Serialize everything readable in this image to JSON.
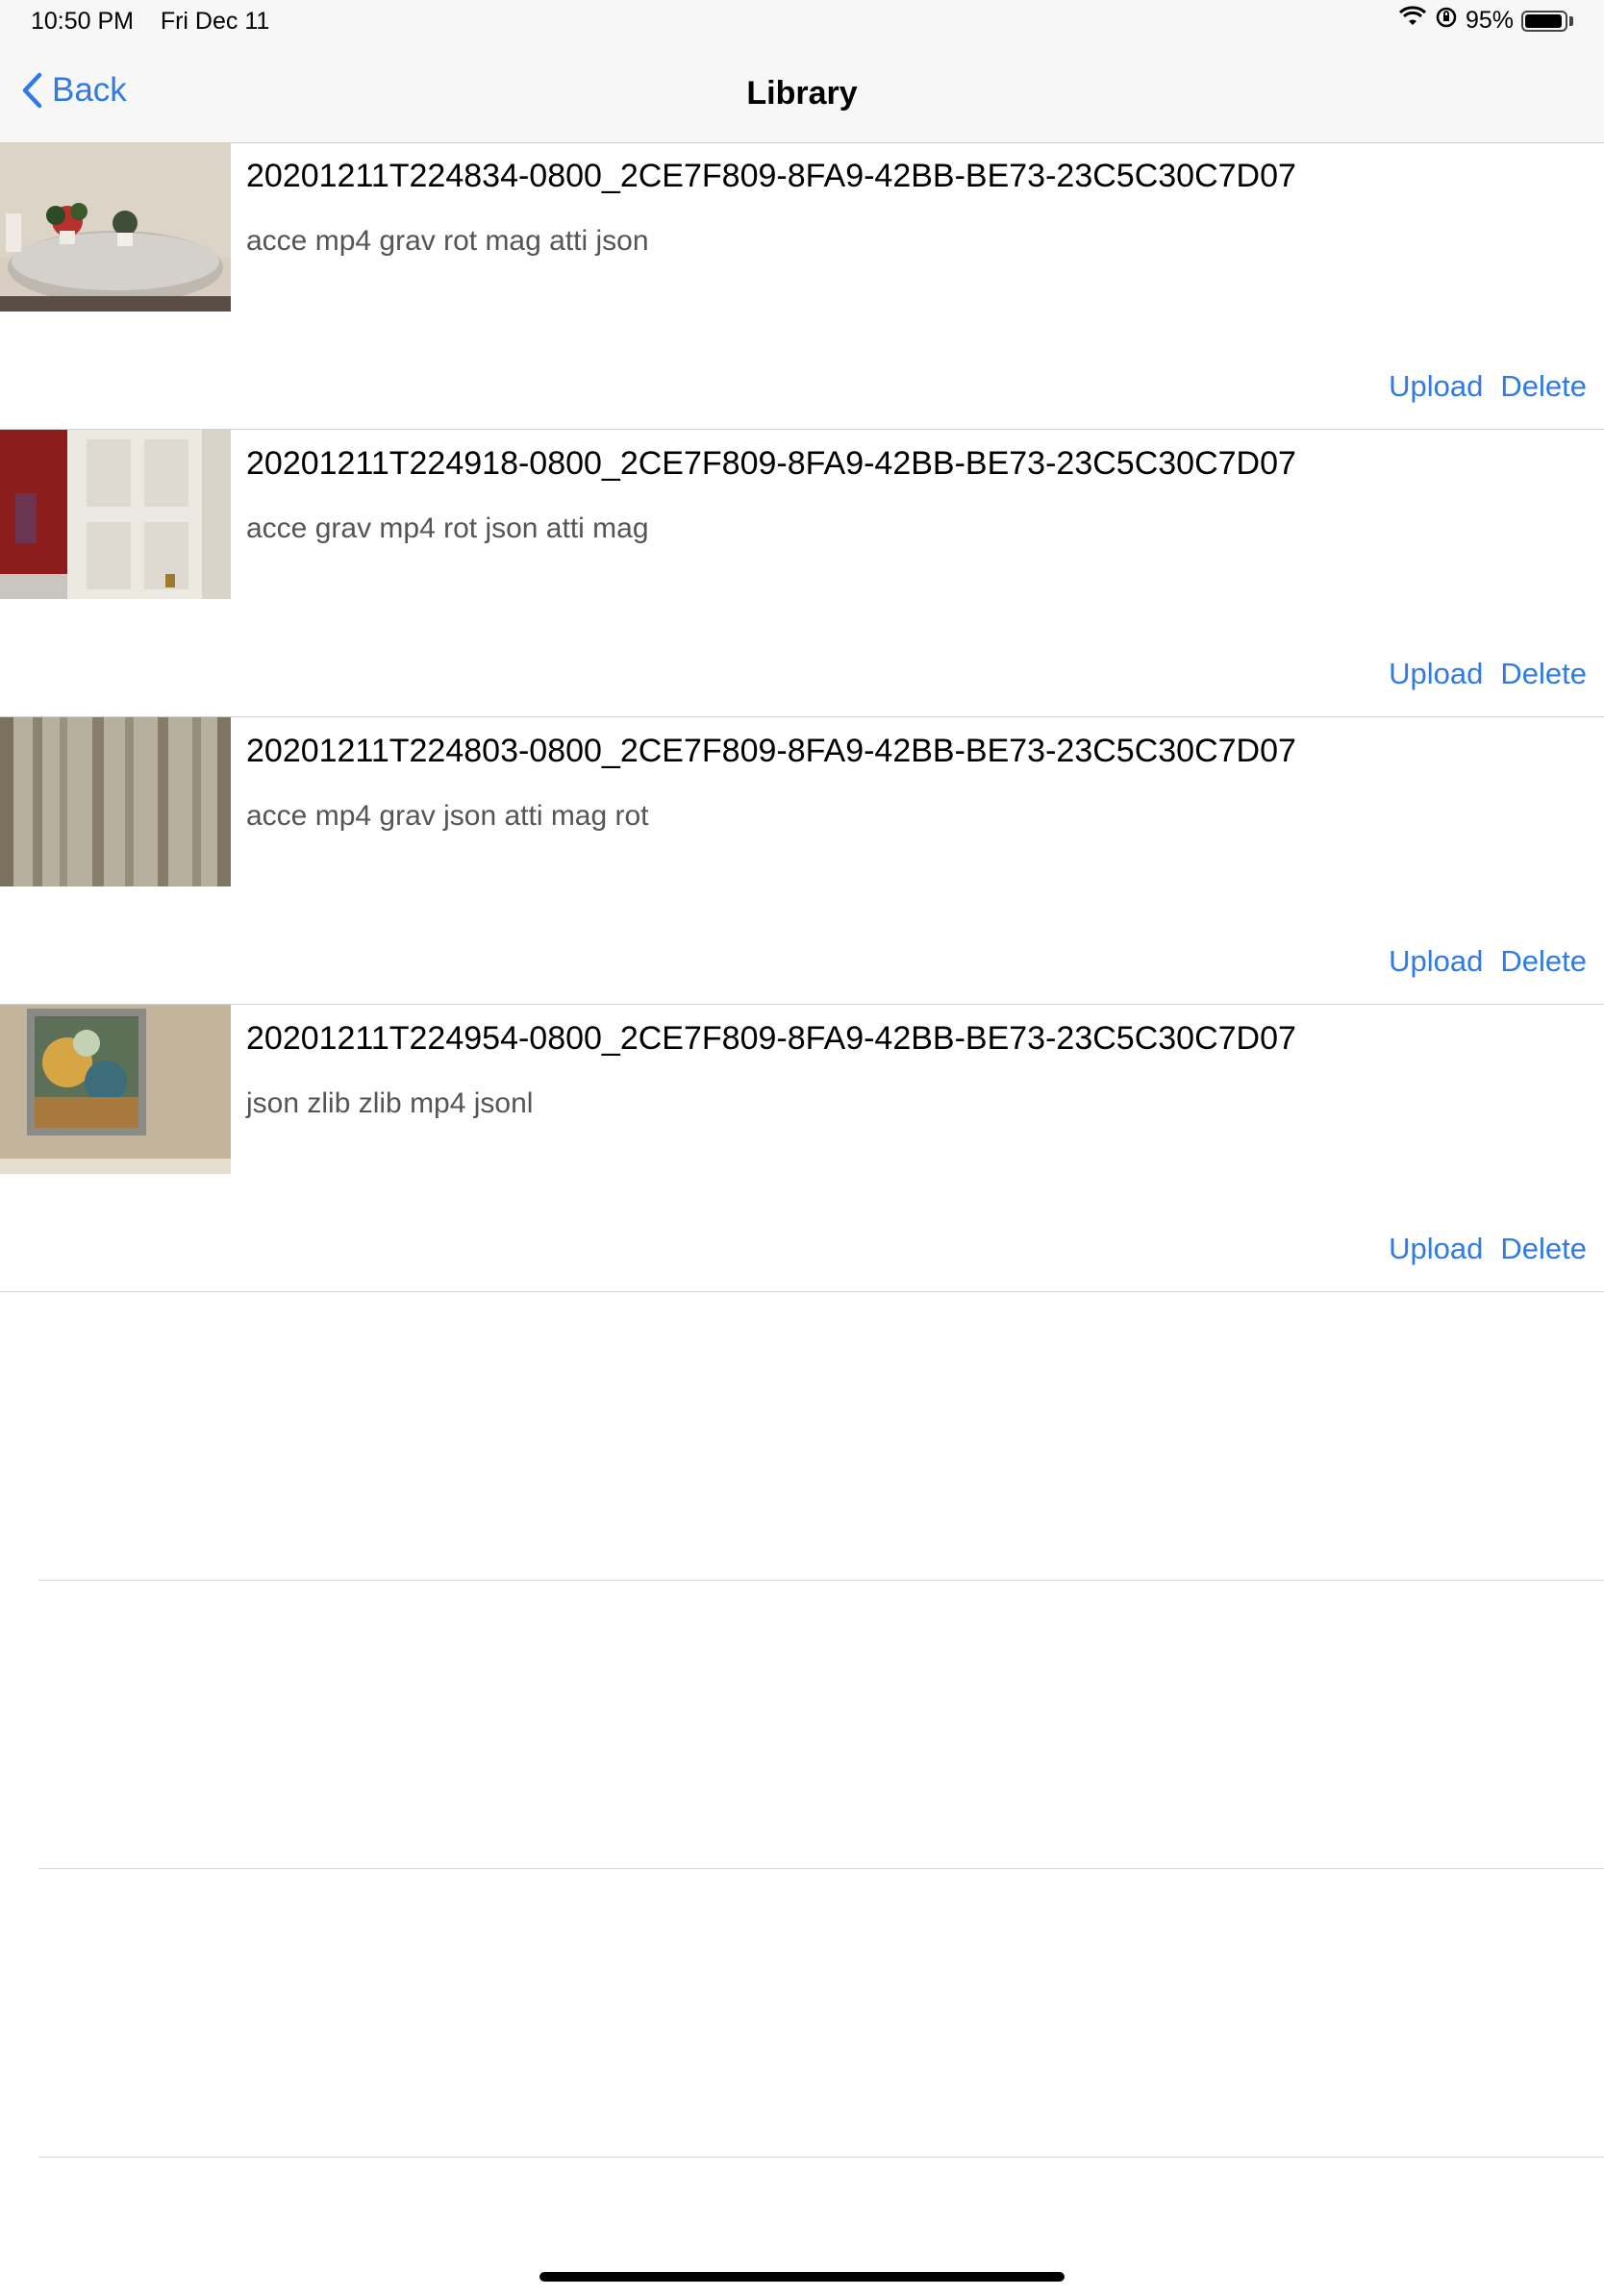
{
  "status_bar": {
    "time": "10:50 PM",
    "date": "Fri Dec 11",
    "battery": "95%",
    "battery_level": 0.95,
    "icons": [
      "wifi-icon",
      "orientation-lock-icon",
      "battery-icon"
    ]
  },
  "nav": {
    "back_label": "Back",
    "title": "Library"
  },
  "items": [
    {
      "title": "20201211T224834-0800_2CE7F809-8FA9-42BB-BE73-23C5C30C7D07",
      "files": "acce mp4 grav rot mag atti json",
      "upload": "Upload",
      "delete": "Delete"
    },
    {
      "title": "20201211T224918-0800_2CE7F809-8FA9-42BB-BE73-23C5C30C7D07",
      "files": "acce grav mp4 rot json atti mag",
      "upload": "Upload",
      "delete": "Delete"
    },
    {
      "title": "20201211T224803-0800_2CE7F809-8FA9-42BB-BE73-23C5C30C7D07",
      "files": "acce mp4 grav json atti mag rot",
      "upload": "Upload",
      "delete": "Delete"
    },
    {
      "title": "20201211T224954-0800_2CE7F809-8FA9-42BB-BE73-23C5C30C7D07",
      "files": "json zlib zlib mp4 jsonl",
      "upload": "Upload",
      "delete": "Delete"
    }
  ],
  "colors": {
    "accent": "#2f7ae5",
    "separator": "#d2d2d2",
    "nav_background": "#f7f7f7"
  }
}
